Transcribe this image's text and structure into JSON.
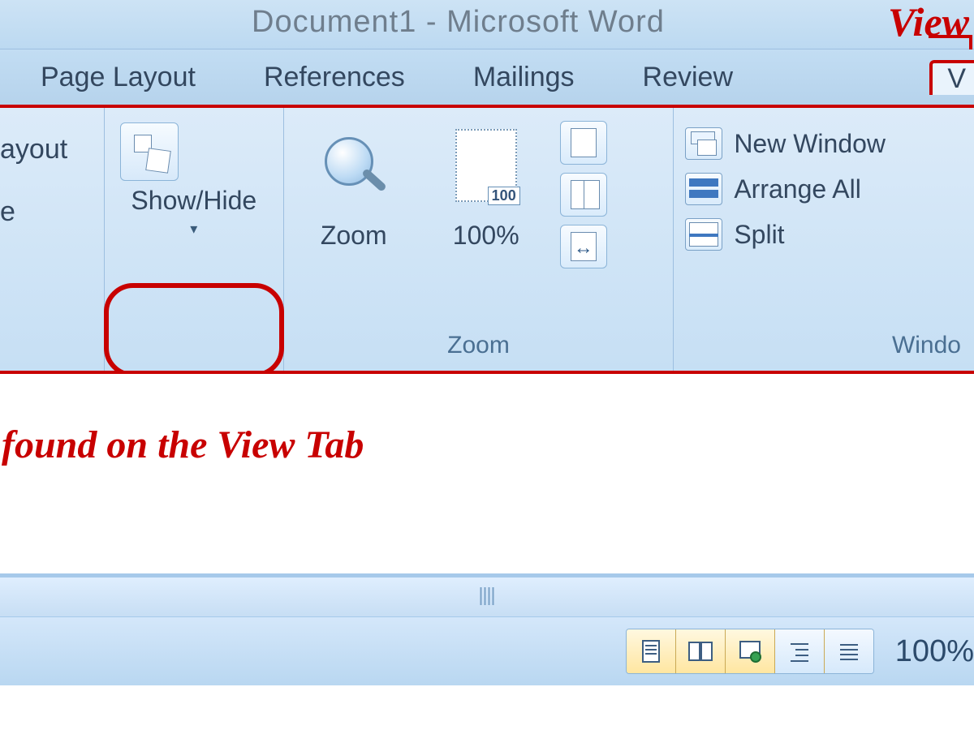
{
  "title": "Document1 - Microsoft Word",
  "annotation": {
    "top_right": "View",
    "caption": "found on the View Tab"
  },
  "tabs": {
    "page_layout": "Page Layout",
    "references": "References",
    "mailings": "Mailings",
    "review": "Review",
    "view": "V"
  },
  "groups": {
    "views": {
      "web_layout_fragment": "ayout",
      "outline_fragment": "e"
    },
    "showhide": {
      "label": "Show/Hide"
    },
    "zoom": {
      "caption": "Zoom",
      "zoom_label": "Zoom",
      "hundred_label": "100%",
      "hundred_tag": "100"
    },
    "window": {
      "caption": "Windo",
      "new_window": "New Window",
      "arrange_all": "Arrange All",
      "split": "Split"
    }
  },
  "statusbar": {
    "zoom_level": "100%"
  }
}
